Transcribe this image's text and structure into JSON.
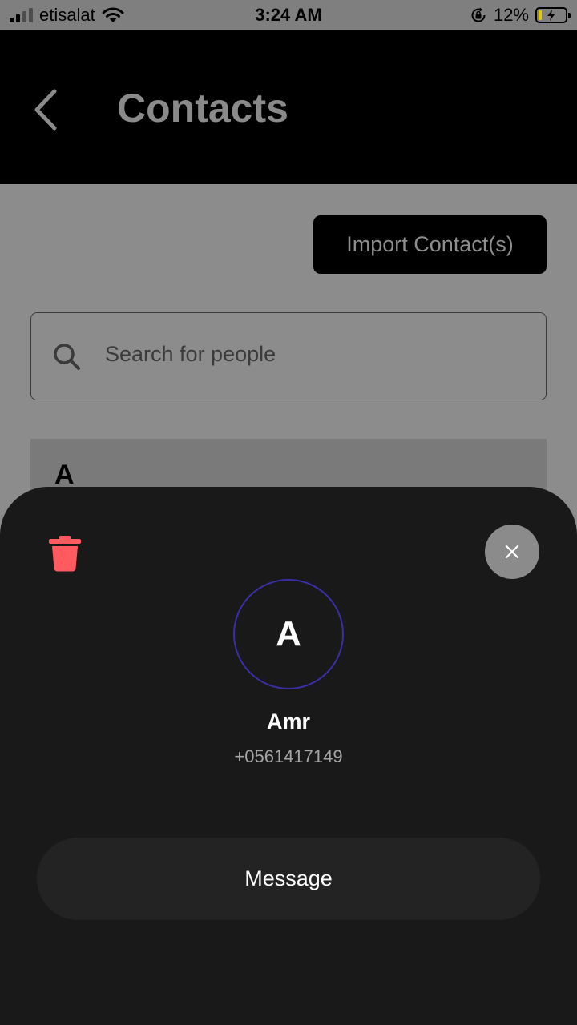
{
  "status_bar": {
    "carrier": "etisalat",
    "time": "3:24 AM",
    "battery": "12%",
    "battery_level": 0.12
  },
  "header": {
    "title": "Contacts"
  },
  "contacts": {
    "import_label": "Import Contact(s)",
    "search_placeholder": "Search for people",
    "section_letter": "A"
  },
  "sheet": {
    "avatar_initial": "A",
    "name": "Amr",
    "phone": "+0561417149",
    "message_label": "Message"
  },
  "colors": {
    "delete_icon": "#ff5a5f",
    "avatar_ring": "#3a2fa6",
    "sheet_background": "#191919"
  }
}
